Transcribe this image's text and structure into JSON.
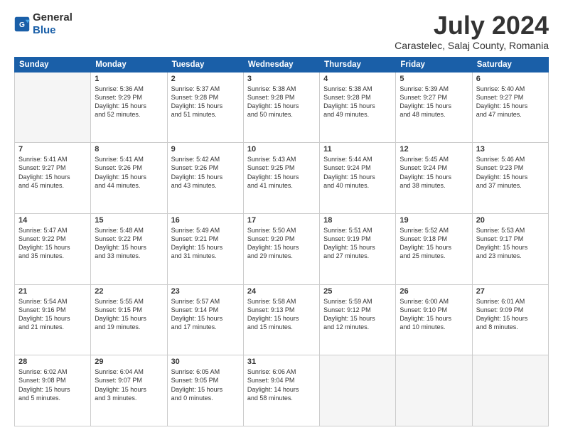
{
  "logo": {
    "general": "General",
    "blue": "Blue"
  },
  "header": {
    "month": "July 2024",
    "location": "Carastelec, Salaj County, Romania"
  },
  "weekdays": [
    "Sunday",
    "Monday",
    "Tuesday",
    "Wednesday",
    "Thursday",
    "Friday",
    "Saturday"
  ],
  "weeks": [
    [
      {
        "day": "",
        "text": ""
      },
      {
        "day": "1",
        "text": "Sunrise: 5:36 AM\nSunset: 9:29 PM\nDaylight: 15 hours\nand 52 minutes."
      },
      {
        "day": "2",
        "text": "Sunrise: 5:37 AM\nSunset: 9:28 PM\nDaylight: 15 hours\nand 51 minutes."
      },
      {
        "day": "3",
        "text": "Sunrise: 5:38 AM\nSunset: 9:28 PM\nDaylight: 15 hours\nand 50 minutes."
      },
      {
        "day": "4",
        "text": "Sunrise: 5:38 AM\nSunset: 9:28 PM\nDaylight: 15 hours\nand 49 minutes."
      },
      {
        "day": "5",
        "text": "Sunrise: 5:39 AM\nSunset: 9:27 PM\nDaylight: 15 hours\nand 48 minutes."
      },
      {
        "day": "6",
        "text": "Sunrise: 5:40 AM\nSunset: 9:27 PM\nDaylight: 15 hours\nand 47 minutes."
      }
    ],
    [
      {
        "day": "7",
        "text": "Sunrise: 5:41 AM\nSunset: 9:27 PM\nDaylight: 15 hours\nand 45 minutes."
      },
      {
        "day": "8",
        "text": "Sunrise: 5:41 AM\nSunset: 9:26 PM\nDaylight: 15 hours\nand 44 minutes."
      },
      {
        "day": "9",
        "text": "Sunrise: 5:42 AM\nSunset: 9:26 PM\nDaylight: 15 hours\nand 43 minutes."
      },
      {
        "day": "10",
        "text": "Sunrise: 5:43 AM\nSunset: 9:25 PM\nDaylight: 15 hours\nand 41 minutes."
      },
      {
        "day": "11",
        "text": "Sunrise: 5:44 AM\nSunset: 9:24 PM\nDaylight: 15 hours\nand 40 minutes."
      },
      {
        "day": "12",
        "text": "Sunrise: 5:45 AM\nSunset: 9:24 PM\nDaylight: 15 hours\nand 38 minutes."
      },
      {
        "day": "13",
        "text": "Sunrise: 5:46 AM\nSunset: 9:23 PM\nDaylight: 15 hours\nand 37 minutes."
      }
    ],
    [
      {
        "day": "14",
        "text": "Sunrise: 5:47 AM\nSunset: 9:22 PM\nDaylight: 15 hours\nand 35 minutes."
      },
      {
        "day": "15",
        "text": "Sunrise: 5:48 AM\nSunset: 9:22 PM\nDaylight: 15 hours\nand 33 minutes."
      },
      {
        "day": "16",
        "text": "Sunrise: 5:49 AM\nSunset: 9:21 PM\nDaylight: 15 hours\nand 31 minutes."
      },
      {
        "day": "17",
        "text": "Sunrise: 5:50 AM\nSunset: 9:20 PM\nDaylight: 15 hours\nand 29 minutes."
      },
      {
        "day": "18",
        "text": "Sunrise: 5:51 AM\nSunset: 9:19 PM\nDaylight: 15 hours\nand 27 minutes."
      },
      {
        "day": "19",
        "text": "Sunrise: 5:52 AM\nSunset: 9:18 PM\nDaylight: 15 hours\nand 25 minutes."
      },
      {
        "day": "20",
        "text": "Sunrise: 5:53 AM\nSunset: 9:17 PM\nDaylight: 15 hours\nand 23 minutes."
      }
    ],
    [
      {
        "day": "21",
        "text": "Sunrise: 5:54 AM\nSunset: 9:16 PM\nDaylight: 15 hours\nand 21 minutes."
      },
      {
        "day": "22",
        "text": "Sunrise: 5:55 AM\nSunset: 9:15 PM\nDaylight: 15 hours\nand 19 minutes."
      },
      {
        "day": "23",
        "text": "Sunrise: 5:57 AM\nSunset: 9:14 PM\nDaylight: 15 hours\nand 17 minutes."
      },
      {
        "day": "24",
        "text": "Sunrise: 5:58 AM\nSunset: 9:13 PM\nDaylight: 15 hours\nand 15 minutes."
      },
      {
        "day": "25",
        "text": "Sunrise: 5:59 AM\nSunset: 9:12 PM\nDaylight: 15 hours\nand 12 minutes."
      },
      {
        "day": "26",
        "text": "Sunrise: 6:00 AM\nSunset: 9:10 PM\nDaylight: 15 hours\nand 10 minutes."
      },
      {
        "day": "27",
        "text": "Sunrise: 6:01 AM\nSunset: 9:09 PM\nDaylight: 15 hours\nand 8 minutes."
      }
    ],
    [
      {
        "day": "28",
        "text": "Sunrise: 6:02 AM\nSunset: 9:08 PM\nDaylight: 15 hours\nand 5 minutes."
      },
      {
        "day": "29",
        "text": "Sunrise: 6:04 AM\nSunset: 9:07 PM\nDaylight: 15 hours\nand 3 minutes."
      },
      {
        "day": "30",
        "text": "Sunrise: 6:05 AM\nSunset: 9:05 PM\nDaylight: 15 hours\nand 0 minutes."
      },
      {
        "day": "31",
        "text": "Sunrise: 6:06 AM\nSunset: 9:04 PM\nDaylight: 14 hours\nand 58 minutes."
      },
      {
        "day": "",
        "text": ""
      },
      {
        "day": "",
        "text": ""
      },
      {
        "day": "",
        "text": ""
      }
    ]
  ]
}
